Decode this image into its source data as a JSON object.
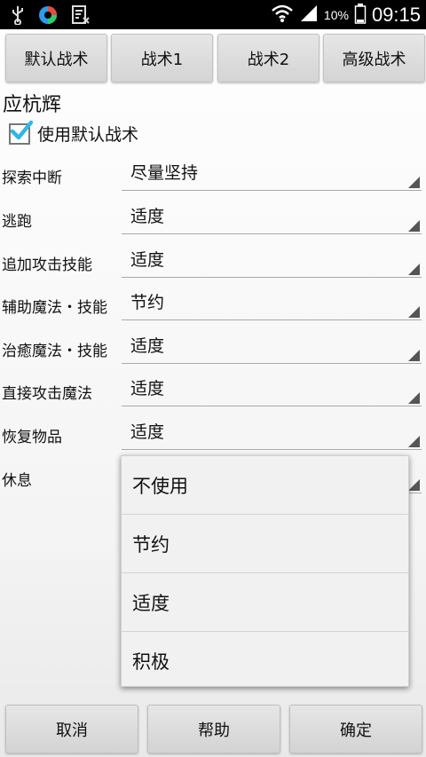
{
  "status_bar": {
    "icons": [
      "usb-icon",
      "app-icon",
      "sim-icon",
      "wifi-icon",
      "signal-icon",
      "battery-icon"
    ],
    "battery": "10%",
    "time": "09:15"
  },
  "tabs": [
    {
      "label": "默认战术"
    },
    {
      "label": "战术1"
    },
    {
      "label": "战术2"
    },
    {
      "label": "高级战术"
    }
  ],
  "character_name": "应杭辉",
  "use_default": {
    "label": "使用默认战术",
    "checked": true
  },
  "settings": [
    {
      "label": "探索中断",
      "value": "尽量坚持"
    },
    {
      "label": "逃跑",
      "value": "适度"
    },
    {
      "label": "追加攻击技能",
      "value": "适度"
    },
    {
      "label": "辅助魔法・技能",
      "value": "节约"
    },
    {
      "label": "治癒魔法・技能",
      "value": "适度"
    },
    {
      "label": "直接攻击魔法",
      "value": "适度"
    },
    {
      "label": "恢复物品",
      "value": "适度"
    },
    {
      "label": "休息",
      "value": ""
    }
  ],
  "dropdown_options": [
    "不使用",
    "节约",
    "适度",
    "积极"
  ],
  "buttons": {
    "cancel": "取消",
    "help": "帮助",
    "ok": "确定"
  },
  "colors": {
    "check_accent": "#33b5e5"
  }
}
